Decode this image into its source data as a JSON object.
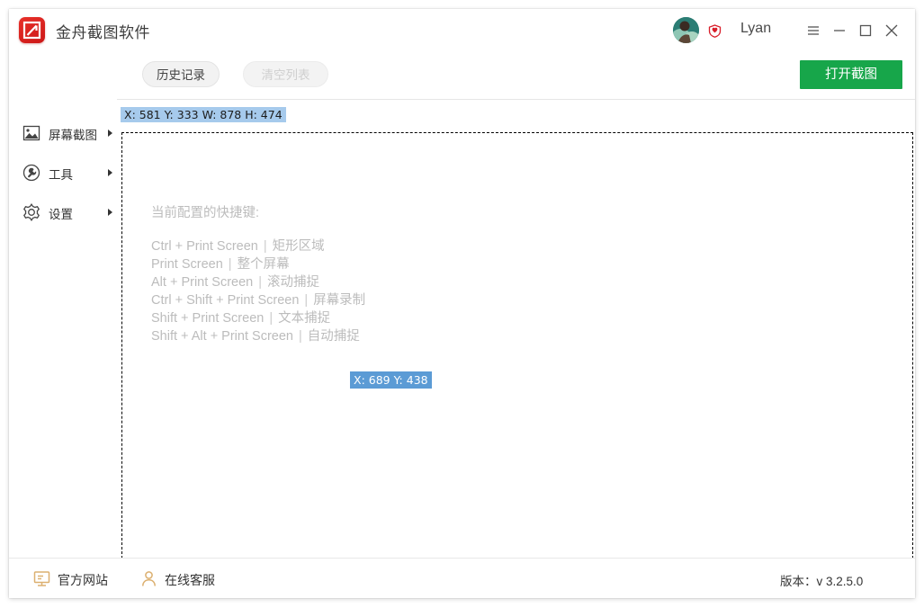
{
  "window": {
    "app_title": "金舟截图软件",
    "logo_icon": "app-logo-icon",
    "username": "Lyan",
    "avatar_icon": "user-avatar",
    "vip_badge_icon": "vip-shield-icon",
    "controls": {
      "menu": "menu-icon",
      "minimize": "minimize-icon",
      "maximize": "maximize-icon",
      "close": "close-icon"
    }
  },
  "sidebar": {
    "items": [
      {
        "label": "屏幕截图",
        "icon": "image-capture-icon",
        "has_submenu": true
      },
      {
        "label": "工具",
        "icon": "wrench-tool-icon",
        "has_submenu": true
      },
      {
        "label": "设置",
        "icon": "gear-settings-icon",
        "has_submenu": true
      }
    ]
  },
  "toolbar": {
    "history_label": "历史记录",
    "clear_list_label": "清空列表",
    "open_screenshot_label": "打开截图",
    "open_screenshot_color": "#17a64a"
  },
  "capture": {
    "coord_chip": "X: 581 Y: 333 W: 878 H: 474",
    "coord_chip_bg": "#a6caec",
    "coord_overlay": "X: 689 Y: 438",
    "coord_overlay_bg": "#5b9bd5",
    "hint_title": "当前配置的快捷键:",
    "shortcuts": [
      {
        "keys": "Ctrl + Print Screen",
        "sep": "|",
        "action": "矩形区域"
      },
      {
        "keys": "Print Screen",
        "sep": "|",
        "action": "整个屏幕"
      },
      {
        "keys": "Alt + Print Screen",
        "sep": "|",
        "action": "滚动捕捉"
      },
      {
        "keys": "Ctrl + Shift + Print Screen",
        "sep": "|",
        "action": "屏幕录制"
      },
      {
        "keys": "Shift + Print Screen",
        "sep": "|",
        "action": "文本捕捉"
      },
      {
        "keys": "Shift + Alt + Print Screen",
        "sep": "|",
        "action": "自动捕捉"
      }
    ]
  },
  "footer": {
    "website_label": "官方网站",
    "website_icon": "monitor-icon",
    "support_label": "在线客服",
    "support_icon": "person-icon",
    "version": "版本：v 3.2.5.0"
  }
}
